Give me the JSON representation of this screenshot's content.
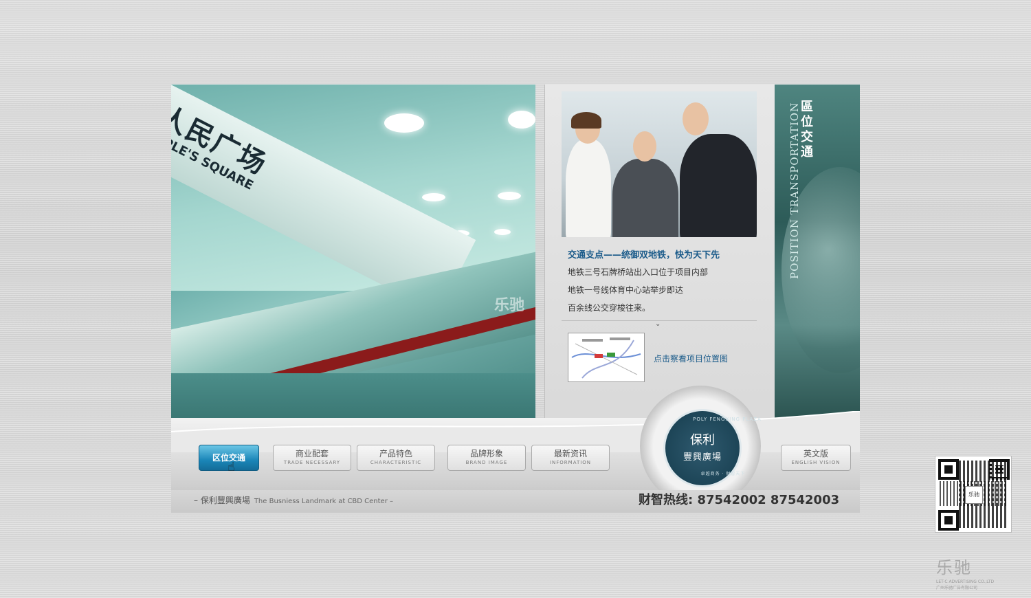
{
  "hero": {
    "sign_cn": "人民广场",
    "sign_en": "PEOPLE'S SQUARE",
    "watermark": "乐驰"
  },
  "middle": {
    "title": "交通支点——统御双地铁，快为天下先",
    "lines": [
      "地铁三号石牌桥站出入口位于项目内部",
      "地铁一号线体育中心站举步即达",
      "百余线公交穿梭往来。"
    ],
    "arrow_icon": "chevron-down-icon",
    "map_link": "点击察看项目位置图"
  },
  "side": {
    "title_cn": "區位交通",
    "title_en": "POSITION TRANSPORTATION"
  },
  "nav": {
    "items": [
      {
        "cn": "区位交通",
        "en": ""
      },
      {
        "cn": "商业配套",
        "en": "TRADE NECESSARY"
      },
      {
        "cn": "产品特色",
        "en": "CHARACTERISTIC"
      },
      {
        "cn": "品牌形象",
        "en": "BRAND IMAGE"
      },
      {
        "cn": "最新资讯",
        "en": "INFORMATION"
      },
      {
        "cn": "英文版",
        "en": "ENGLISH VISION"
      }
    ]
  },
  "logo": {
    "ring_top": "POLY FENGXING PLAZA",
    "cn1": "保利",
    "cn2": "豐興廣場",
    "ring_bottom": "卓越商务 · 财智天下"
  },
  "footer": {
    "slogan_cn": "– 保利豐興廣場",
    "slogan_en": "The Busniess Landmark at CBD Center –",
    "hotline": "财智热线: 87542002  87542003"
  },
  "brand": {
    "mark": "乐驰",
    "line1": "LET-C ADVERTISING CO.,LTD",
    "line2": "广州乐驰广告有限公司"
  },
  "colors": {
    "accent_blue": "#1a86b8",
    "title_blue": "#1b5b8a",
    "teal": "#2d5b58"
  }
}
